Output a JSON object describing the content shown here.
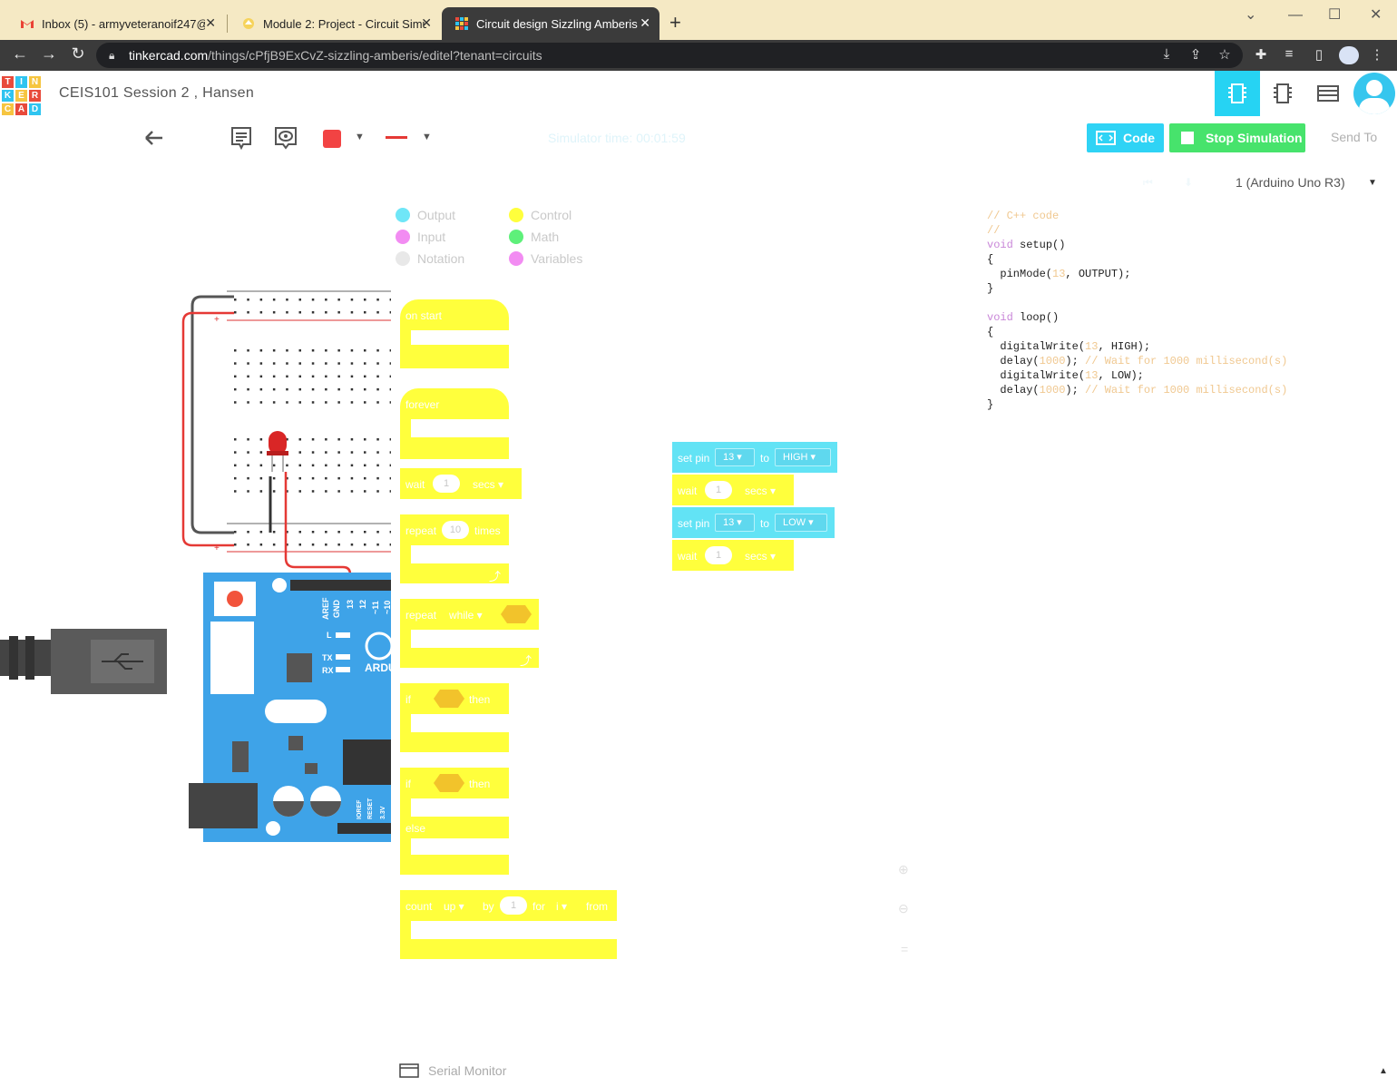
{
  "browser": {
    "tabs": [
      {
        "title": "Inbox (5) - armyveteranoif247@g",
        "active": false,
        "favicon": "gmail-icon"
      },
      {
        "title": "Module 2: Project - Circuit Simula",
        "active": false,
        "favicon": "module-icon"
      },
      {
        "title": "Circuit design Sizzling Amberis | T",
        "active": true,
        "favicon": "tinkercad-icon"
      }
    ],
    "new_tab": "+",
    "url_host": "tinkercad.com",
    "url_path": "/things/cPfjB9ExCvZ-sizzling-amberis/editel?tenant=circuits"
  },
  "app": {
    "logo_letters": [
      "T",
      "I",
      "N",
      "K",
      "E",
      "R",
      "C",
      "A",
      "D"
    ],
    "project_title": "CEIS101 Session 2 , Hansen",
    "simulator_time": "Simulator time: 00:01:59",
    "code_label": "Code",
    "stop_label": "Stop Simulation",
    "send_to": "Send To",
    "chip_select": "1 (Arduino Uno R3)"
  },
  "legend": [
    {
      "label": "Output",
      "color": "#6fe6f7"
    },
    {
      "label": "Control",
      "color": "#ffff3c"
    },
    {
      "label": "Input",
      "color": "#f28cf2"
    },
    {
      "label": "Math",
      "color": "#5ef07a"
    },
    {
      "label": "Notation",
      "color": "#e8e8e8"
    },
    {
      "label": "Variables",
      "color": "#f28cf2"
    }
  ],
  "palette": {
    "on_start": "on start",
    "forever": "forever",
    "wait": "wait",
    "wait_val": "1",
    "secs": "secs ▾",
    "repeat": "repeat",
    "repeat_val": "10",
    "times": "times",
    "repeat_while": "repeat",
    "while": "while ▾",
    "if": "if",
    "then": "then",
    "if2": "if",
    "then2": "then",
    "else": "else",
    "count": "count",
    "up": "up ▾",
    "by": "by",
    "by_val": "1",
    "for": "for",
    "var": "i ▾",
    "from": "from"
  },
  "workspace": {
    "setpin1": {
      "label": "set pin",
      "pin": "13 ▾",
      "to": "to",
      "value": "HIGH ▾"
    },
    "wait1": {
      "label": "wait",
      "value": "1",
      "unit": "secs ▾"
    },
    "setpin2": {
      "label": "set pin",
      "pin": "13 ▾",
      "to": "to",
      "value": "LOW ▾"
    },
    "wait2": {
      "label": "wait",
      "value": "1",
      "unit": "secs ▾"
    }
  },
  "code_lines": [
    "// C++ code",
    "//",
    "void setup()",
    "{",
    "  pinMode(13, OUTPUT);",
    "}",
    "",
    "void loop()",
    "{",
    "  digitalWrite(13, HIGH);",
    "  delay(1000); // Wait for 1000 millisecond(s)",
    "  digitalWrite(13, LOW);",
    "  delay(1000); // Wait for 1000 millisecond(s)",
    "}"
  ],
  "board_labels": {
    "aref": "AREF",
    "gnd": "GND",
    "p13": "13",
    "p12": "12",
    "p11": "~11",
    "p10": "~10",
    "l": "L",
    "tx": "TX",
    "rx": "RX",
    "brand": "ARDU",
    "ioref": "IOREF",
    "reset": "RESET",
    "v33": "3.3V"
  },
  "serial_monitor": "Serial Monitor"
}
